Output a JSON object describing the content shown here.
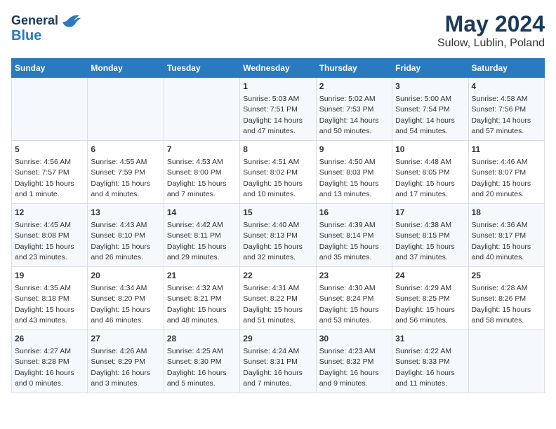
{
  "header": {
    "logo_line1": "General",
    "logo_line2": "Blue",
    "title": "May 2024",
    "subtitle": "Sulow, Lublin, Poland"
  },
  "days_of_week": [
    "Sunday",
    "Monday",
    "Tuesday",
    "Wednesday",
    "Thursday",
    "Friday",
    "Saturday"
  ],
  "weeks": [
    [
      {
        "day": "",
        "info": ""
      },
      {
        "day": "",
        "info": ""
      },
      {
        "day": "",
        "info": ""
      },
      {
        "day": "1",
        "info": "Sunrise: 5:03 AM\nSunset: 7:51 PM\nDaylight: 14 hours\nand 47 minutes."
      },
      {
        "day": "2",
        "info": "Sunrise: 5:02 AM\nSunset: 7:53 PM\nDaylight: 14 hours\nand 50 minutes."
      },
      {
        "day": "3",
        "info": "Sunrise: 5:00 AM\nSunset: 7:54 PM\nDaylight: 14 hours\nand 54 minutes."
      },
      {
        "day": "4",
        "info": "Sunrise: 4:58 AM\nSunset: 7:56 PM\nDaylight: 14 hours\nand 57 minutes."
      }
    ],
    [
      {
        "day": "5",
        "info": "Sunrise: 4:56 AM\nSunset: 7:57 PM\nDaylight: 15 hours\nand 1 minute."
      },
      {
        "day": "6",
        "info": "Sunrise: 4:55 AM\nSunset: 7:59 PM\nDaylight: 15 hours\nand 4 minutes."
      },
      {
        "day": "7",
        "info": "Sunrise: 4:53 AM\nSunset: 8:00 PM\nDaylight: 15 hours\nand 7 minutes."
      },
      {
        "day": "8",
        "info": "Sunrise: 4:51 AM\nSunset: 8:02 PM\nDaylight: 15 hours\nand 10 minutes."
      },
      {
        "day": "9",
        "info": "Sunrise: 4:50 AM\nSunset: 8:03 PM\nDaylight: 15 hours\nand 13 minutes."
      },
      {
        "day": "10",
        "info": "Sunrise: 4:48 AM\nSunset: 8:05 PM\nDaylight: 15 hours\nand 17 minutes."
      },
      {
        "day": "11",
        "info": "Sunrise: 4:46 AM\nSunset: 8:07 PM\nDaylight: 15 hours\nand 20 minutes."
      }
    ],
    [
      {
        "day": "12",
        "info": "Sunrise: 4:45 AM\nSunset: 8:08 PM\nDaylight: 15 hours\nand 23 minutes."
      },
      {
        "day": "13",
        "info": "Sunrise: 4:43 AM\nSunset: 8:10 PM\nDaylight: 15 hours\nand 26 minutes."
      },
      {
        "day": "14",
        "info": "Sunrise: 4:42 AM\nSunset: 8:11 PM\nDaylight: 15 hours\nand 29 minutes."
      },
      {
        "day": "15",
        "info": "Sunrise: 4:40 AM\nSunset: 8:13 PM\nDaylight: 15 hours\nand 32 minutes."
      },
      {
        "day": "16",
        "info": "Sunrise: 4:39 AM\nSunset: 8:14 PM\nDaylight: 15 hours\nand 35 minutes."
      },
      {
        "day": "17",
        "info": "Sunrise: 4:38 AM\nSunset: 8:15 PM\nDaylight: 15 hours\nand 37 minutes."
      },
      {
        "day": "18",
        "info": "Sunrise: 4:36 AM\nSunset: 8:17 PM\nDaylight: 15 hours\nand 40 minutes."
      }
    ],
    [
      {
        "day": "19",
        "info": "Sunrise: 4:35 AM\nSunset: 8:18 PM\nDaylight: 15 hours\nand 43 minutes."
      },
      {
        "day": "20",
        "info": "Sunrise: 4:34 AM\nSunset: 8:20 PM\nDaylight: 15 hours\nand 46 minutes."
      },
      {
        "day": "21",
        "info": "Sunrise: 4:32 AM\nSunset: 8:21 PM\nDaylight: 15 hours\nand 48 minutes."
      },
      {
        "day": "22",
        "info": "Sunrise: 4:31 AM\nSunset: 8:22 PM\nDaylight: 15 hours\nand 51 minutes."
      },
      {
        "day": "23",
        "info": "Sunrise: 4:30 AM\nSunset: 8:24 PM\nDaylight: 15 hours\nand 53 minutes."
      },
      {
        "day": "24",
        "info": "Sunrise: 4:29 AM\nSunset: 8:25 PM\nDaylight: 15 hours\nand 56 minutes."
      },
      {
        "day": "25",
        "info": "Sunrise: 4:28 AM\nSunset: 8:26 PM\nDaylight: 15 hours\nand 58 minutes."
      }
    ],
    [
      {
        "day": "26",
        "info": "Sunrise: 4:27 AM\nSunset: 8:28 PM\nDaylight: 16 hours\nand 0 minutes."
      },
      {
        "day": "27",
        "info": "Sunrise: 4:26 AM\nSunset: 8:29 PM\nDaylight: 16 hours\nand 3 minutes."
      },
      {
        "day": "28",
        "info": "Sunrise: 4:25 AM\nSunset: 8:30 PM\nDaylight: 16 hours\nand 5 minutes."
      },
      {
        "day": "29",
        "info": "Sunrise: 4:24 AM\nSunset: 8:31 PM\nDaylight: 16 hours\nand 7 minutes."
      },
      {
        "day": "30",
        "info": "Sunrise: 4:23 AM\nSunset: 8:32 PM\nDaylight: 16 hours\nand 9 minutes."
      },
      {
        "day": "31",
        "info": "Sunrise: 4:22 AM\nSunset: 8:33 PM\nDaylight: 16 hours\nand 11 minutes."
      },
      {
        "day": "",
        "info": ""
      }
    ]
  ]
}
